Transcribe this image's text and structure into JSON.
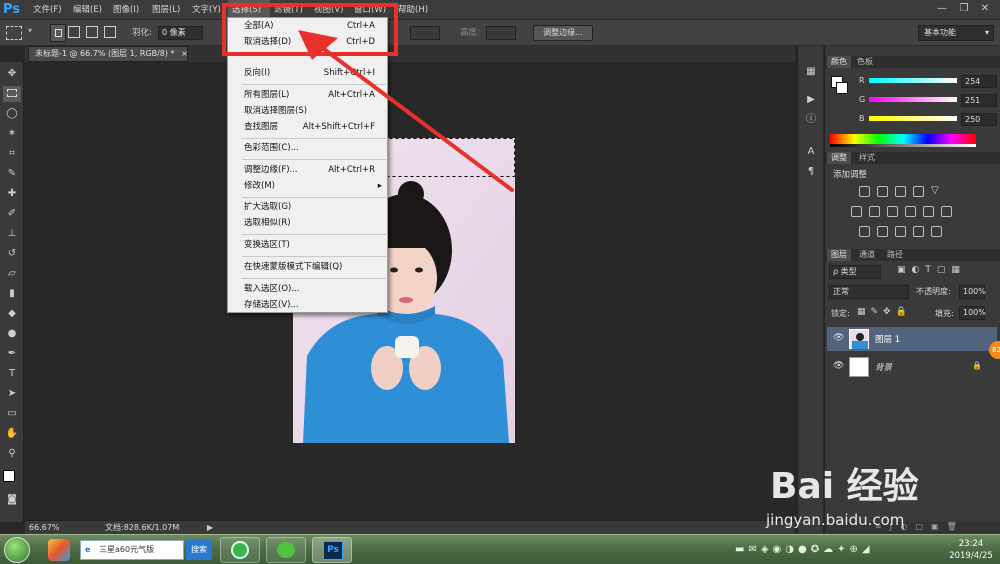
{
  "app": {
    "logo": "Ps"
  },
  "menubar": {
    "items": [
      "文件(F)",
      "编辑(E)",
      "图像(I)",
      "图层(L)",
      "文字(Y)",
      "选择(S)",
      "滤镜(T)",
      "视图(V)",
      "窗口(W)",
      "帮助(H)"
    ],
    "window_controls": [
      "—",
      "❐",
      "✕"
    ]
  },
  "options_bar": {
    "feather_label": "羽化:",
    "feather_value": "0 像素",
    "height_label": "高度:",
    "refine_edge_button": "调整边缘...",
    "workspace": "基本功能"
  },
  "document": {
    "tab_title": "未标题-1 @ 66.7% (图层 1, RGB/8) *",
    "close": "×"
  },
  "select_menu": {
    "items": [
      {
        "label": "全部(A)",
        "shortcut": "Ctrl+A"
      },
      {
        "label": "取消选择(D)",
        "shortcut": "Ctrl+D"
      },
      {
        "label": "反向(I)",
        "shortcut": "Shift+Ctrl+I"
      },
      {
        "label": "所有图层(L)",
        "shortcut": "Alt+Ctrl+A"
      },
      {
        "label": "取消选择图层(S)",
        "shortcut": ""
      },
      {
        "label": "查找图层",
        "shortcut": "Alt+Shift+Ctrl+F"
      },
      {
        "label": "色彩范围(C)...",
        "shortcut": ""
      },
      {
        "label": "调整边缘(F)...",
        "shortcut": "Alt+Ctrl+R"
      },
      {
        "label": "修改(M)",
        "shortcut": "▸"
      },
      {
        "label": "扩大选取(G)",
        "shortcut": ""
      },
      {
        "label": "选取相似(R)",
        "shortcut": ""
      },
      {
        "label": "变换选区(T)",
        "shortcut": ""
      },
      {
        "label": "在快速蒙版模式下编辑(Q)",
        "shortcut": ""
      },
      {
        "label": "载入选区(O)...",
        "shortcut": ""
      },
      {
        "label": "存储选区(V)...",
        "shortcut": ""
      }
    ]
  },
  "status": {
    "zoom": "66.67%",
    "doc_info": "文档:828.6K/1.07M"
  },
  "color_panel": {
    "tabs": [
      "颜色",
      "色板"
    ],
    "channels": [
      {
        "name": "R",
        "value": "254"
      },
      {
        "name": "G",
        "value": "251"
      },
      {
        "name": "B",
        "value": "250"
      }
    ]
  },
  "adjust_panel": {
    "tabs": [
      "调整",
      "样式"
    ],
    "title": "添加调整"
  },
  "layers_panel": {
    "tabs": [
      "图层",
      "通道",
      "路径"
    ],
    "filter_kind": "ρ 类型",
    "blend_mode": "正常",
    "opacity_label": "不透明度:",
    "opacity_value": "100%",
    "lock_label": "锁定:",
    "fill_label": "填充:",
    "fill_value": "100%",
    "layers": [
      {
        "name": "图层 1",
        "selected": true
      },
      {
        "name": "背景",
        "selected": false,
        "locked": true
      }
    ],
    "badge": "82"
  },
  "taskbar": {
    "search_text": "三星a60元气版",
    "search_button": "搜索",
    "time": "23:24",
    "date": "2019/4/25"
  },
  "watermark": {
    "brand": "Bai 经验",
    "url": "jingyan.baidu.com"
  },
  "colors": {
    "accent_red": "#e8312a",
    "ps_blue": "#31a8ff",
    "sweater_blue": "#2f8fd6"
  }
}
